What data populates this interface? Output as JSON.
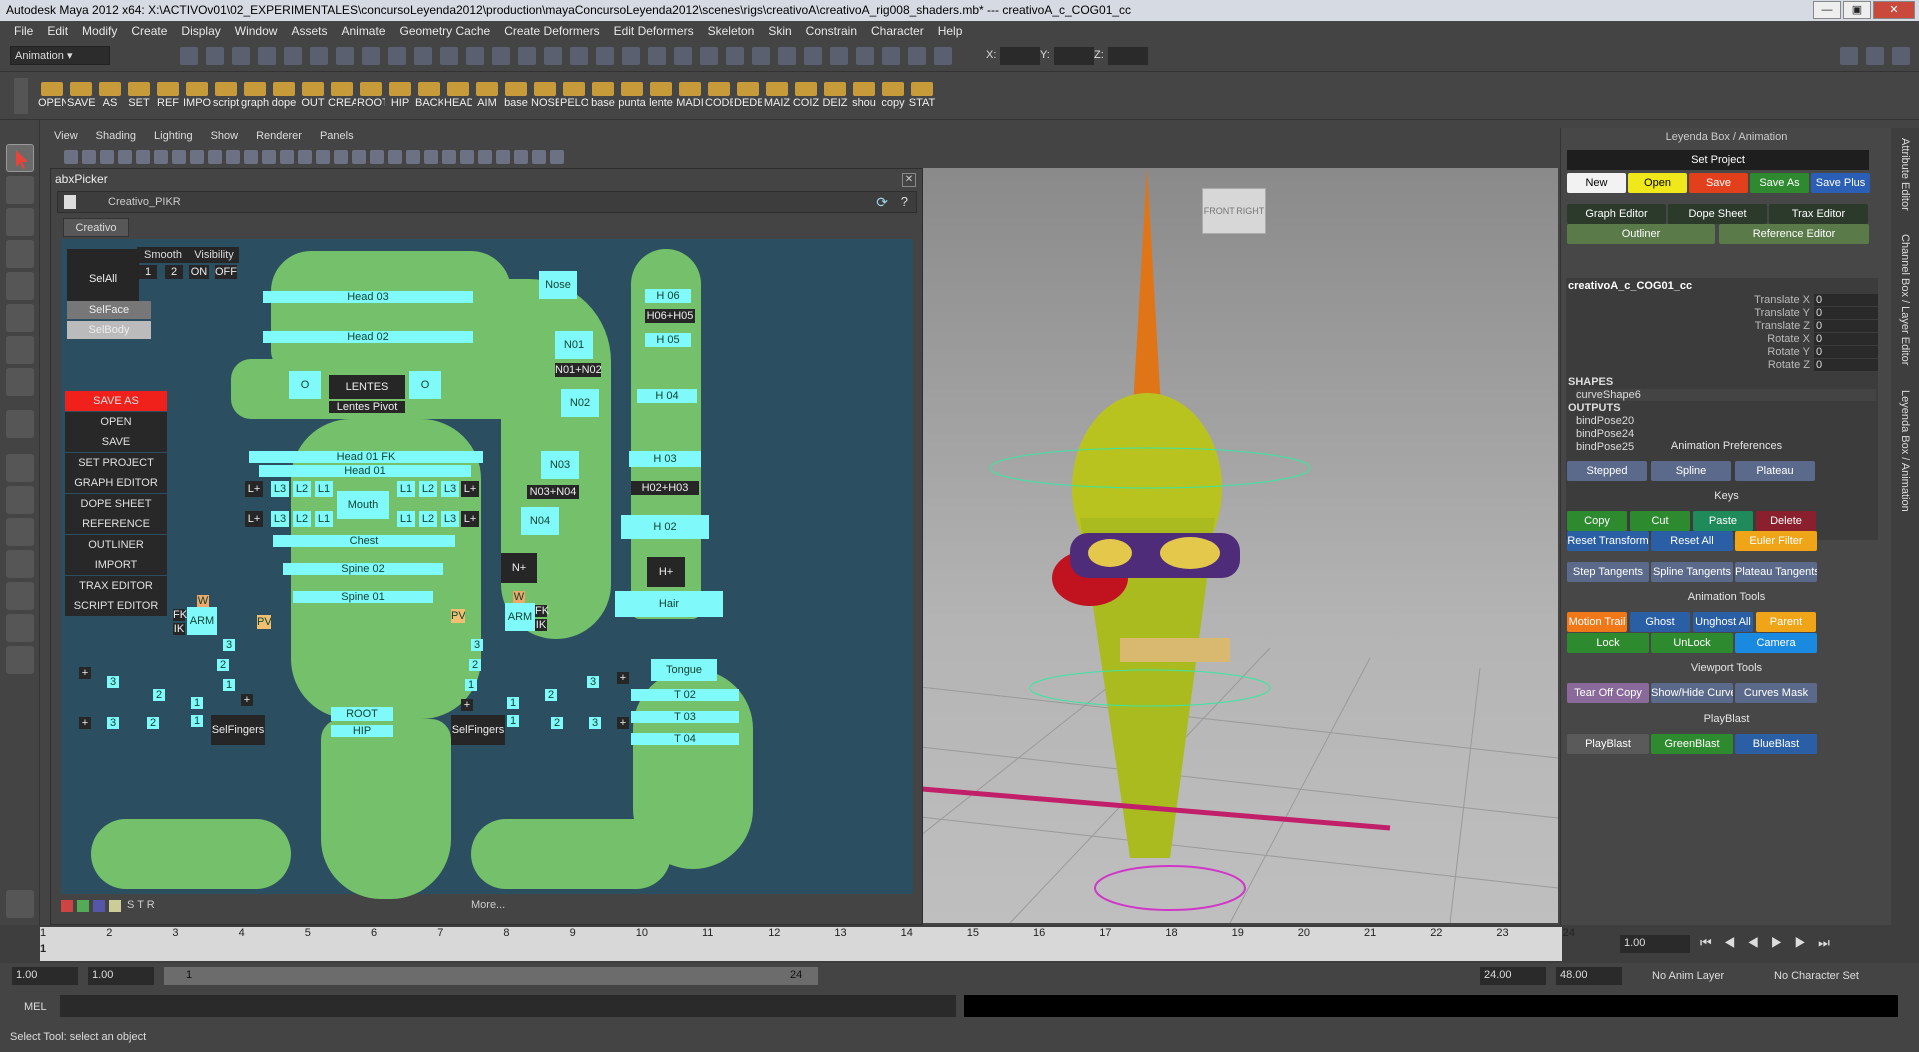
{
  "window": {
    "title": "Autodesk Maya 2012 x64: X:\\ACTIVOv01\\02_EXPERIMENTALES\\concursoLeyenda2012\\production\\mayaConcursoLeyenda2012\\scenes\\rigs\\creativoA\\creativoA_rig008_shaders.mb*  ---  creativoA_c_COG01_cc"
  },
  "menu": [
    "File",
    "Edit",
    "Modify",
    "Create",
    "Display",
    "Window",
    "Assets",
    "Animate",
    "Geometry Cache",
    "Create Deformers",
    "Edit Deformers",
    "Skeleton",
    "Skin",
    "Constrain",
    "Character",
    "Help"
  ],
  "status": {
    "mode": "Animation",
    "x_label": "X:",
    "y_label": "Y:",
    "z_label": "Z:"
  },
  "shelf": [
    "OPEN",
    "SAVE",
    "AS",
    "SET",
    "REF",
    "IMPO",
    "script",
    "graph",
    "dope",
    "OUT",
    "CREA",
    "ROOT",
    "HIP",
    "BACK",
    "HEAD",
    "AIM",
    "base",
    "NOSE",
    "PELO",
    "base",
    "punta",
    "lente",
    "MADI",
    "CODE",
    "DEDE",
    "MAIZ",
    "COIZ",
    "DEIZ",
    "shou",
    "copy",
    "STAT"
  ],
  "viewport_menu": [
    "View",
    "Shading",
    "Lighting",
    "Show",
    "Renderer",
    "Panels"
  ],
  "viewcube": {
    "front": "FRONT",
    "right": "RIGHT"
  },
  "picker": {
    "title": "abxPicker",
    "name": "Creativo_PIKR",
    "tab": "Creativo",
    "more": "More...",
    "selall": "SelAll",
    "smooth": "Smooth",
    "visibility": "Visibility",
    "smooth_vals": [
      "1",
      "2"
    ],
    "vis_vals": [
      "ON",
      "OFF"
    ],
    "selface": "SelFace",
    "selbody": "SelBody",
    "side": [
      "SAVE AS",
      "OPEN",
      "SAVE",
      "SET PROJECT",
      "GRAPH EDITOR",
      "DOPE SHEET",
      "REFERENCE EDITOR",
      "OUTLINER",
      "IMPORT",
      "TRAX EDITOR",
      "SCRIPT EDITOR"
    ],
    "head": {
      "h03": "Head 03",
      "h02": "Head 02",
      "o": "O",
      "lentes": "LENTES",
      "lentes_pivot": "Lentes Pivot",
      "h01fk": "Head 01 FK",
      "h01": "Head 01",
      "mouth": "Mouth",
      "chest": "Chest",
      "spine02": "Spine 02",
      "spine01": "Spine 01",
      "root": "ROOT",
      "hip": "HIP"
    },
    "lips": {
      "l1": "L1",
      "l2": "L2",
      "l3": "L3",
      "lp": "L+"
    },
    "arms": {
      "w": "W",
      "fk": "FK",
      "ik": "IK",
      "arm": "ARM",
      "pv": "PV",
      "selfingers": "SelFingers",
      "n1": "1",
      "n2": "2",
      "n3": "3",
      "plus": "+"
    },
    "nose": {
      "nose": "Nose",
      "n01": "N01",
      "n01n02": "N01+N02",
      "n02": "N02",
      "n03": "N03",
      "n03n04": "N03+N04",
      "n04": "N04",
      "nplus": "N+"
    },
    "hat": {
      "h06": "H 06",
      "h06h05": "H06+H05",
      "h05": "H 05",
      "h04": "H 04",
      "h03": "H 03",
      "h02h03": "H02+H03",
      "h02": "H 02",
      "hplus": "H+",
      "hair": "Hair"
    },
    "tongue": {
      "tongue": "Tongue",
      "t02": "T 02",
      "t03": "T 03",
      "t04": "T 04"
    }
  },
  "rpanel": {
    "title": "Leyenda Box / Animation",
    "set_project": "Set Project",
    "file_btns": [
      {
        "label": "New",
        "color": "#f2f2f2",
        "text": "#000"
      },
      {
        "label": "Open",
        "color": "#f0e81a",
        "text": "#000"
      },
      {
        "label": "Save",
        "color": "#e2401c",
        "text": "#fff"
      },
      {
        "label": "Save As",
        "color": "#2f8a2f",
        "text": "#fff"
      },
      {
        "label": "Save Plus",
        "color": "#2a5fb5",
        "text": "#fff"
      }
    ],
    "editors": [
      "Graph Editor",
      "Dope Sheet",
      "Trax Editor"
    ],
    "outliner": "Outliner",
    "reference": "Reference Editor",
    "node": "creativoA_c_COG01_cc",
    "channels": [
      "Translate X",
      "Translate Y",
      "Translate Z",
      "Rotate X",
      "Rotate Y",
      "Rotate Z"
    ],
    "channel_vals": [
      "0",
      "0",
      "0",
      "0",
      "0",
      "0"
    ],
    "shapes": "SHAPES",
    "shape": "curveShape6",
    "outputs": "OUTPUTS",
    "output_list": [
      "bindPose20",
      "bindPose24",
      "bindPose25"
    ],
    "anim_prefs": "Animation Preferences",
    "prefs": [
      "Stepped",
      "Spline",
      "Plateau"
    ],
    "keys": "Keys",
    "key_btns": [
      "Copy",
      "Cut",
      "Paste",
      "Delete"
    ],
    "reset": [
      "Reset Transform",
      "Reset All",
      "Euler Filter"
    ],
    "tangents": [
      "Step Tangents",
      "Spline Tangents",
      "Plateau Tangents"
    ],
    "anim_tools": "Animation Tools",
    "at1": [
      "Motion Trail",
      "Ghost",
      "Unghost All",
      "Parent"
    ],
    "at2": [
      "Lock",
      "UnLock",
      "Camera"
    ],
    "viewport_tools": "Viewport Tools",
    "vt": [
      "Tear Off Copy",
      "Show/Hide Curves",
      "Curves Mask"
    ],
    "playblast": "PlayBlast",
    "pb": [
      "PlayBlast",
      "GreenBlast",
      "BlueBlast"
    ]
  },
  "right_tabs": [
    "Attribute Editor",
    "Channel Box / Layer Editor",
    "Leyenda Box / Animation"
  ],
  "timeline": {
    "ticks": [
      "1",
      "2",
      "3",
      "4",
      "5",
      "6",
      "7",
      "8",
      "9",
      "10",
      "11",
      "12",
      "13",
      "14",
      "15",
      "16",
      "17",
      "18",
      "19",
      "20",
      "21",
      "22",
      "23",
      "24"
    ],
    "current": "1.00",
    "current_frame": "1"
  },
  "range": {
    "start": "1.00",
    "start2": "1.00",
    "slider_start": "1",
    "slider_end": "24",
    "end": "24.00",
    "end2": "48.00",
    "anim_layer": "No Anim Layer",
    "character": "No Character Set"
  },
  "cmd": {
    "label": "MEL"
  },
  "help": "Select Tool: select an object"
}
